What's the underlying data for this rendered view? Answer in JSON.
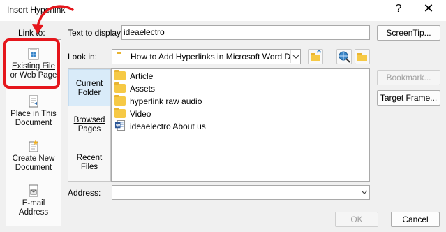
{
  "window": {
    "title": "Insert Hyperlink",
    "help_glyph": "?",
    "close_glyph": "✕"
  },
  "colors": {
    "highlight_box": "#e5161c",
    "arrow": "#e5161c",
    "selected_tab": "#d9ebf9",
    "folder": "#f6c945"
  },
  "sidebar": {
    "label": "Link to:",
    "items": [
      {
        "line1": "Existing File",
        "line2": "or Web Page",
        "icon": "web-page-icon"
      },
      {
        "line1": "Place in This",
        "line2": "Document",
        "icon": "place-in-document-icon"
      },
      {
        "line1": "Create New",
        "line2": "Document",
        "icon": "new-document-icon"
      },
      {
        "line1": "E-mail",
        "line2": "Address",
        "icon": "email-icon"
      }
    ]
  },
  "text_to_display": {
    "label": "Text to display:",
    "value": "ideaelectro"
  },
  "screentip_button": "ScreenTip...",
  "look_in": {
    "label": "Look in:",
    "value": "How to Add Hyperlinks in Microsoft Word D",
    "icons": [
      "up-folder-icon",
      "browse-web-icon",
      "browse-file-icon"
    ]
  },
  "tabs": [
    {
      "line1": "Current",
      "line2": "Folder"
    },
    {
      "line1": "Browsed",
      "line2": "Pages"
    },
    {
      "line1": "Recent",
      "line2": "Files"
    }
  ],
  "files": [
    {
      "name": "Article",
      "type": "folder"
    },
    {
      "name": "Assets",
      "type": "folder"
    },
    {
      "name": "hyperlink raw audio",
      "type": "folder"
    },
    {
      "name": "Video",
      "type": "folder"
    },
    {
      "name": "ideaelectro About us",
      "type": "word-doc"
    }
  ],
  "right_buttons": {
    "bookmark": "Bookmark...",
    "target_frame": "Target Frame..."
  },
  "address": {
    "label": "Address:",
    "value": ""
  },
  "footer": {
    "ok": "OK",
    "cancel": "Cancel"
  }
}
